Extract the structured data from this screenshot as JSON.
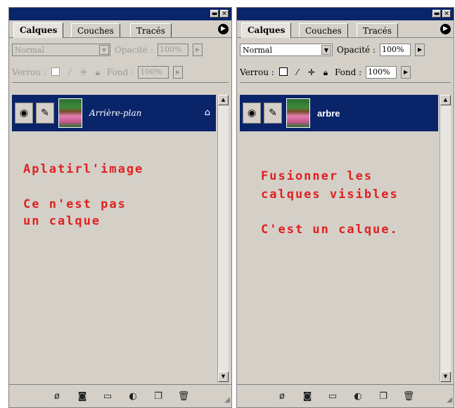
{
  "left_panel": {
    "tabs": [
      "Calques",
      "Couches",
      "Tracés"
    ],
    "blend_mode": "Normal",
    "opacity_label": "Opacité :",
    "opacity_value": "100%",
    "lock_label": "Verrou :",
    "fill_label": "Fond :",
    "fill_value": "100%",
    "layer_name": "Arrière-plan",
    "note_line1": "Aplatirl'image",
    "note_line2": "Ce n'est pas",
    "note_line3": "un calque"
  },
  "right_panel": {
    "tabs": [
      "Calques",
      "Couches",
      "Tracés"
    ],
    "blend_mode": "Normal",
    "opacity_label": "Opacité :",
    "opacity_value": "100%",
    "lock_label": "Verrou :",
    "fill_label": "Fond :",
    "fill_value": "100%",
    "layer_name": "arbre",
    "note_line1": "Fusionner les",
    "note_line2": "calques visibles",
    "note_line3": "C'est un calque."
  },
  "colors": {
    "panel_bg": "#d4d0c8",
    "title_bar": "#0a246a",
    "selected_layer": "#0a246a",
    "note_text": "#e02020"
  },
  "icons": {
    "eye": "eye-icon",
    "brush": "brush-icon",
    "lock": "lock-icon",
    "menu": "palette-menu-icon"
  }
}
